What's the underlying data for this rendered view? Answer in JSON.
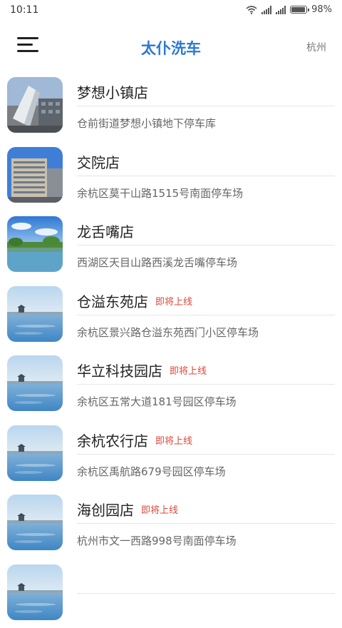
{
  "status": {
    "time": "10:11",
    "battery": "98%",
    "battery_level": 0.98
  },
  "header": {
    "title": "太仆洗车",
    "city": "杭州",
    "menu_icon": "hamburger-menu-icon"
  },
  "stores": [
    {
      "name": "梦想小镇店",
      "tag": "",
      "address": "仓前街道梦想小镇地下停车库",
      "thumb": "modern-building-sculpture"
    },
    {
      "name": "交院店",
      "tag": "",
      "address": "余杭区莫干山路1515号南面停车场",
      "thumb": "office-building"
    },
    {
      "name": "龙舌嘴店",
      "tag": "",
      "address": "西湖区天目山路西溪龙舌嘴停车场",
      "thumb": "lake-trees"
    },
    {
      "name": "仓溢东苑店",
      "tag": "即将上线",
      "address": "余杭区景兴路仓溢东苑西门小区停车场",
      "thumb": "lake-pavilion"
    },
    {
      "name": "华立科技园店",
      "tag": "即将上线",
      "address": "余杭区五常大道181号园区停车场",
      "thumb": "lake-pavilion"
    },
    {
      "name": "余杭农行店",
      "tag": "即将上线",
      "address": "余杭区禹航路679号园区停车场",
      "thumb": "lake-pavilion"
    },
    {
      "name": "海创园店",
      "tag": "即将上线",
      "address": "杭州市文一西路998号南面停车场",
      "thumb": "lake-pavilion"
    },
    {
      "name": "",
      "tag": "",
      "address": "",
      "thumb": "lake-pavilion"
    }
  ]
}
